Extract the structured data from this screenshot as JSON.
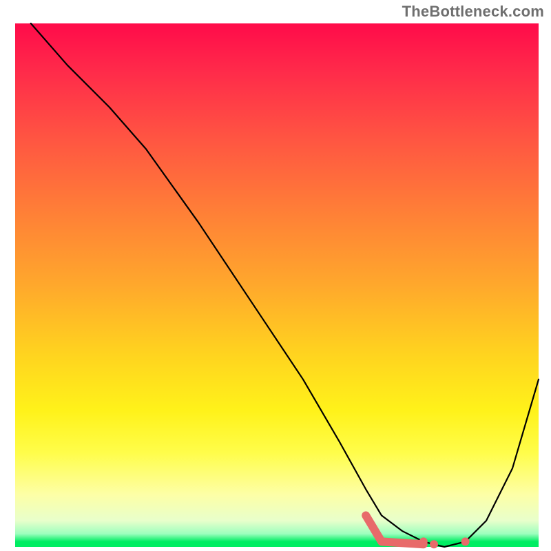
{
  "attribution": "TheBottleneck.com",
  "chart_data": {
    "type": "line",
    "title": "",
    "xlabel": "",
    "ylabel": "",
    "xlim": [
      0,
      100
    ],
    "ylim": [
      0,
      100
    ],
    "series": [
      {
        "name": "bottleneck-curve",
        "x": [
          3,
          10,
          18,
          25,
          35,
          45,
          55,
          62,
          67,
          70,
          74,
          78,
          82,
          86,
          90,
          95,
          100
        ],
        "values": [
          100,
          92,
          84,
          76,
          62,
          47,
          32,
          20,
          11,
          6,
          3,
          1,
          0,
          1,
          5,
          15,
          32
        ]
      }
    ],
    "minimum_zone": {
      "start_x": 67,
      "end_x": 86,
      "min_x": 82,
      "min_value": 0
    },
    "highlight_points": [
      {
        "x": 78,
        "y": 1
      },
      {
        "x": 80,
        "y": 0.5
      },
      {
        "x": 86,
        "y": 1
      }
    ],
    "gradient_stops": [
      {
        "pos": 0.0,
        "color": "#ff0b4a"
      },
      {
        "pos": 0.5,
        "color": "#ffa82c"
      },
      {
        "pos": 0.8,
        "color": "#fff21a"
      },
      {
        "pos": 0.97,
        "color": "#9dffbe"
      },
      {
        "pos": 1.0,
        "color": "#00ed63"
      }
    ]
  }
}
